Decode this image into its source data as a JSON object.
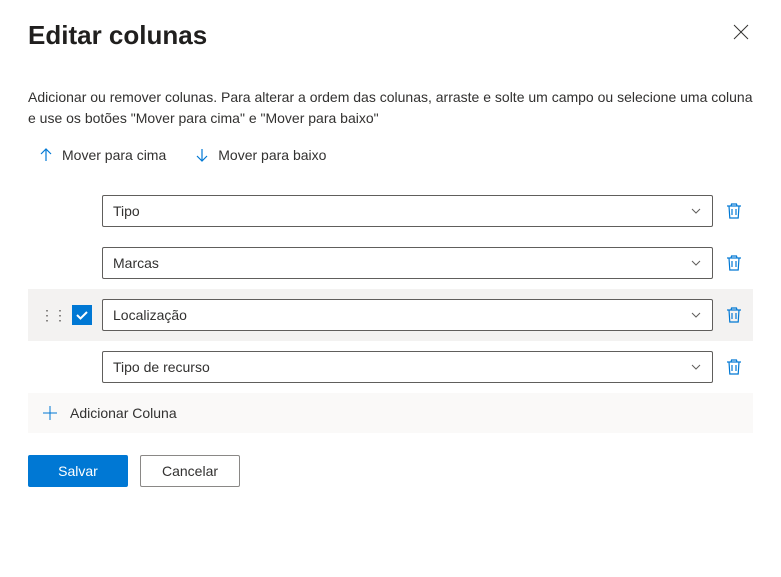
{
  "header": {
    "title": "Editar colunas"
  },
  "description": "Adicionar ou remover colunas. Para alterar a ordem das colunas, arraste e solte um campo ou selecione uma coluna e use os botões \"Mover para cima\" e \"Mover para baixo\"",
  "actions": {
    "move_up": "Mover para cima",
    "move_down": "Mover para baixo"
  },
  "columns": [
    {
      "label": "Tipo",
      "selected": false
    },
    {
      "label": "Marcas",
      "selected": false
    },
    {
      "label": "Localização",
      "selected": true
    },
    {
      "label": "Tipo de recurso",
      "selected": false
    }
  ],
  "add_column_label": "Adicionar Coluna",
  "footer": {
    "save": "Salvar",
    "cancel": "Cancelar"
  }
}
